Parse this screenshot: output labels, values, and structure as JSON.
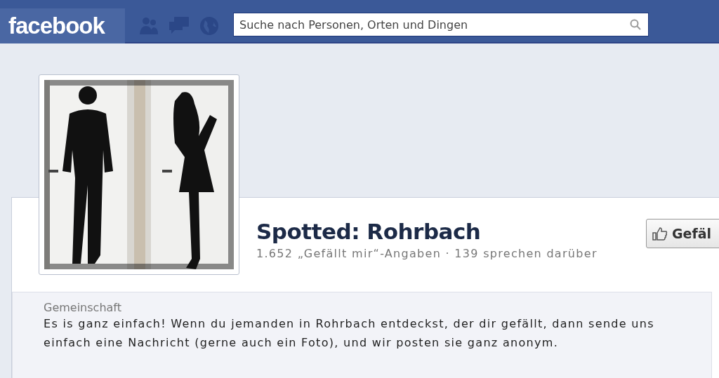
{
  "topbar": {
    "logo": "facebook",
    "search": {
      "placeholder": "Suche nach Personen, Orten und Dingen"
    }
  },
  "page": {
    "title": "Spotted: Rohrbach",
    "stats": "1.652 „Gefällt mir“-Angaben · 139 sprechen darüber",
    "like_button": "Gefäl"
  },
  "about": {
    "category": "Gemeinschaft",
    "description": "Es is ganz einfach! Wenn du jemanden in Rohrbach entdeckst, der dir gefällt, dann sende uns einfach eine Nachricht (gerne auch ein Foto), und wir posten sie ganz anonym."
  }
}
